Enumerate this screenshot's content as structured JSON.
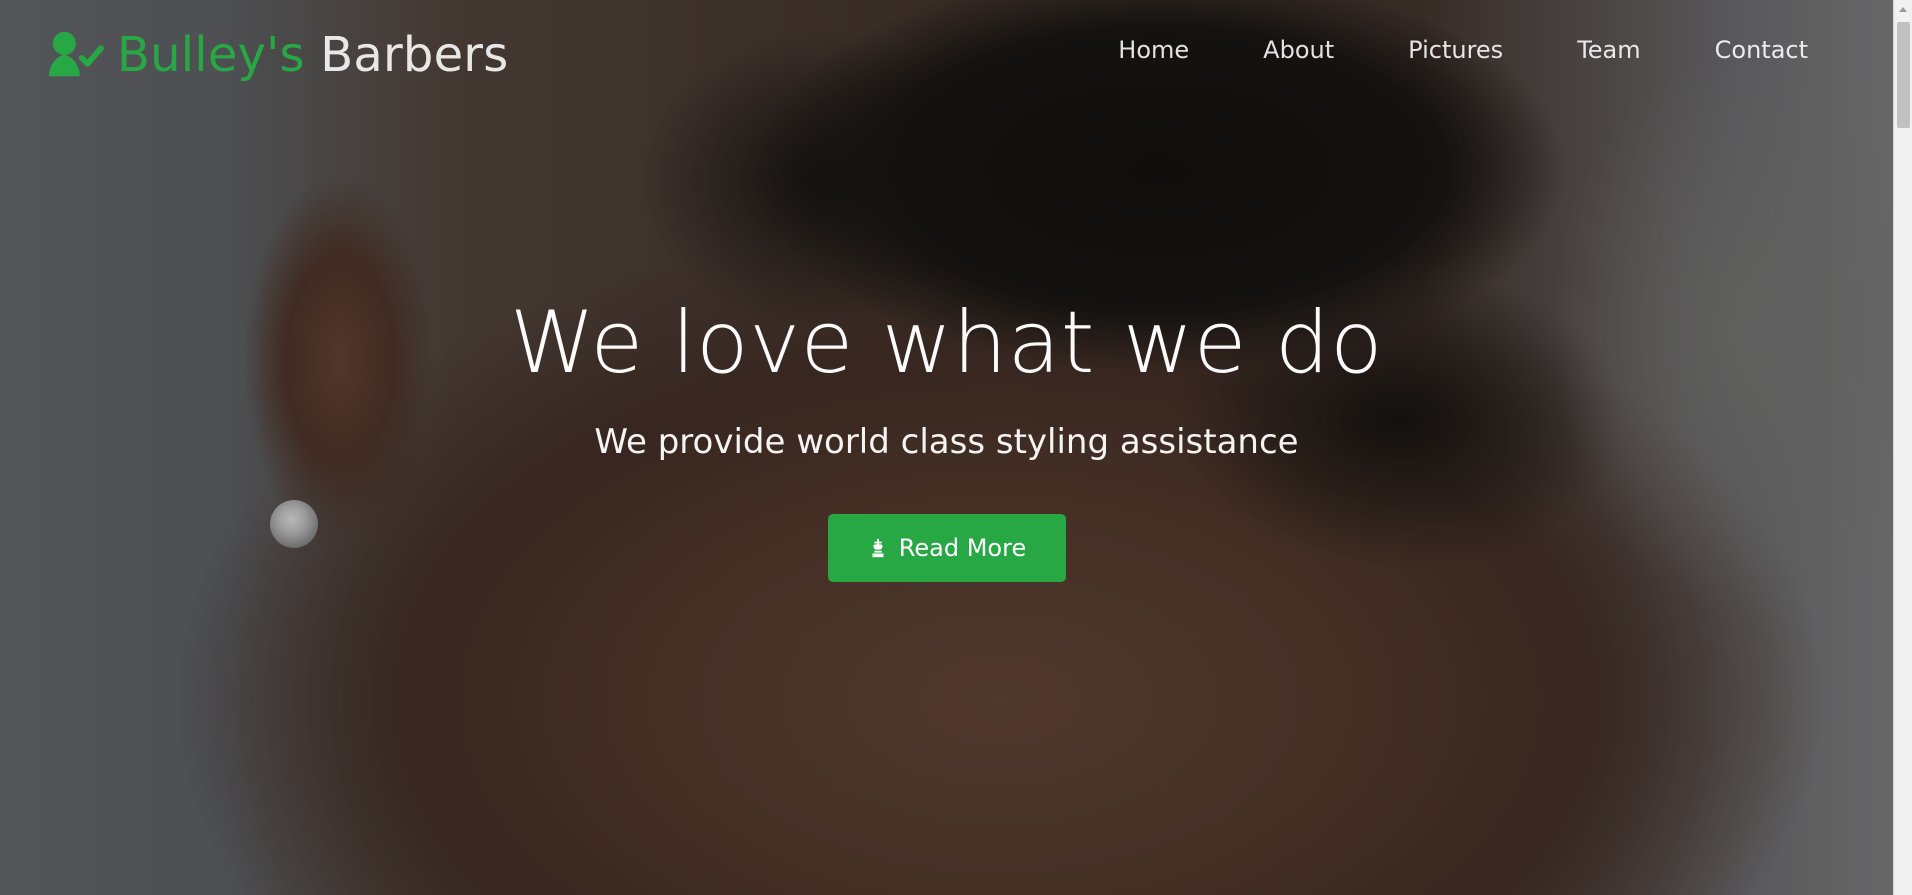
{
  "nav": {
    "brand": {
      "part1": "Bulley's",
      "part2": "Barbers",
      "icon": "user-check-icon",
      "accent_color": "#28a745"
    },
    "links": [
      {
        "label": "Home"
      },
      {
        "label": "About"
      },
      {
        "label": "Pictures"
      },
      {
        "label": "Team"
      },
      {
        "label": "Contact"
      }
    ]
  },
  "hero": {
    "headline": "We love what we do",
    "subhead": "We provide world class styling assistance",
    "cta_label": "Read More",
    "cta_icon": "chess-king-icon",
    "cta_color": "#28a745"
  }
}
